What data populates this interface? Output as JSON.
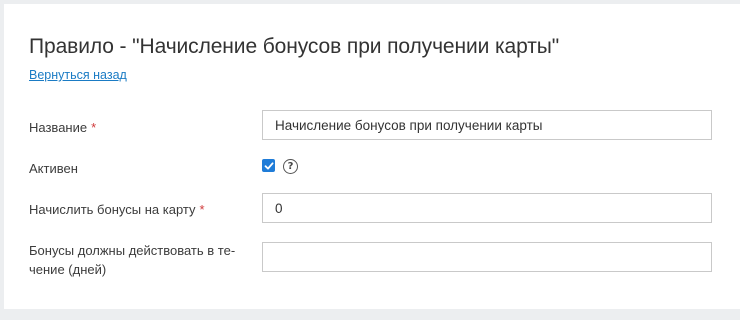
{
  "page": {
    "title": "Правило - \"Начисление бонусов при получении карты\"",
    "back_link": "Вернуться назад"
  },
  "form": {
    "name": {
      "label": "Название",
      "required_mark": "*",
      "value": "Начисление бонусов при получении карты"
    },
    "active": {
      "label": "Активен",
      "checked": true,
      "help_icon": "question-circle-icon",
      "help_glyph": "?"
    },
    "bonus_amount": {
      "label": "Начислить бонусы на карту",
      "required_mark": "*",
      "value": "0"
    },
    "validity_days": {
      "label_line1": "Бонусы должны действовать в те-",
      "label_line2": "чение (дней)",
      "value": ""
    }
  },
  "colors": {
    "link": "#1a7bc4",
    "required": "#d0393a",
    "checkbox": "#1f7cd8"
  }
}
